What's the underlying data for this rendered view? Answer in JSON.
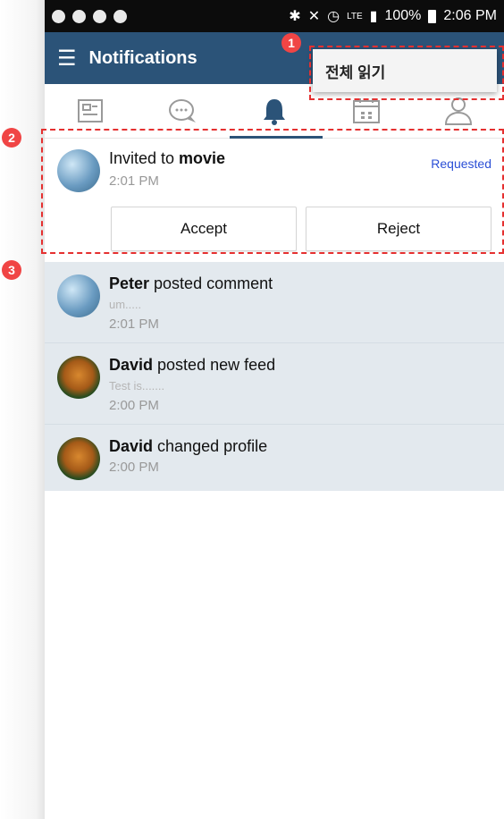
{
  "statusbar": {
    "time": "2:06 PM",
    "battery": "100%",
    "network": "LTE"
  },
  "appbar": {
    "title": "Notifications"
  },
  "popup_menu": {
    "items": [
      {
        "label": "전체 읽기"
      }
    ]
  },
  "tabs": [
    {
      "name": "feed",
      "icon": "news-icon"
    },
    {
      "name": "chat",
      "icon": "chat-icon"
    },
    {
      "name": "notifications",
      "icon": "bell-icon",
      "active": true
    },
    {
      "name": "calendar",
      "icon": "calendar-icon"
    },
    {
      "name": "profile",
      "icon": "person-icon"
    }
  ],
  "invitation": {
    "prefix": "Invited to ",
    "target": "movie",
    "time": "2:01 PM",
    "status": "Requested",
    "accept_label": "Accept",
    "reject_label": "Reject"
  },
  "notifications": [
    {
      "actor": "Peter",
      "action": " posted comment",
      "snippet": "um.....",
      "time": "2:01 PM"
    },
    {
      "actor": "David",
      "action": " posted new feed",
      "snippet": "Test is.......",
      "time": "2:00 PM"
    },
    {
      "actor": "David",
      "action": " changed profile",
      "time": "2:00 PM"
    }
  ],
  "annotations": [
    "1",
    "2",
    "3"
  ],
  "colors": {
    "appbar": "#2b5378",
    "accent": "#2b4fd6",
    "annotation": "#e53030",
    "list_bg": "#e3e9ee"
  }
}
